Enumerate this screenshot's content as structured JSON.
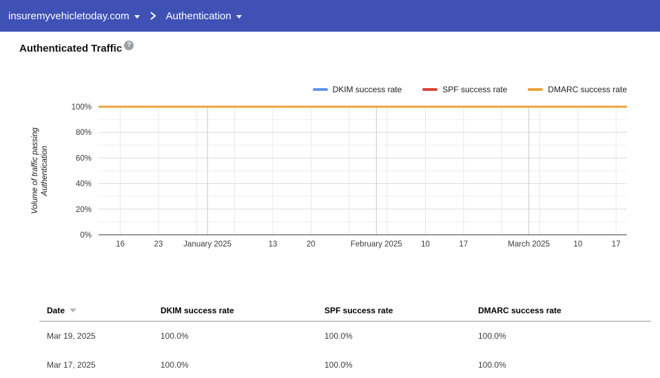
{
  "header": {
    "domain": "insuremyvehicletoday.com",
    "section": "Authentication",
    "bg_color": "#3F51B5"
  },
  "page": {
    "title": "Authenticated Traffic",
    "help_glyph": "?"
  },
  "chart_data": {
    "type": "line",
    "title": "Authenticated Traffic",
    "legend_position": "top-right",
    "grid": true,
    "y_axis": {
      "label": "Volume of traffic passing Authentication",
      "label_lines": [
        "Volume of traffic passing",
        "Authentication"
      ],
      "range": [
        0,
        100
      ],
      "tick_values": [
        0,
        20,
        40,
        60,
        80,
        100
      ],
      "tick_labels": [
        "0%",
        "20%",
        "40%",
        "60%",
        "80%",
        "100%"
      ],
      "minor_gridline_step_percent": 10
    },
    "x_axis": {
      "ticks": [
        {
          "pos": 0.0412,
          "label": "16",
          "month_boundary": false
        },
        {
          "pos": 0.1134,
          "label": "23",
          "month_boundary": false
        },
        {
          "pos": 0.1856,
          "label": "",
          "month_boundary": false
        },
        {
          "pos": 0.2062,
          "label": "January 2025",
          "month_boundary": true
        },
        {
          "pos": 0.2577,
          "label": "",
          "month_boundary": false
        },
        {
          "pos": 0.3299,
          "label": "13",
          "month_boundary": false
        },
        {
          "pos": 0.4021,
          "label": "20",
          "month_boundary": false
        },
        {
          "pos": 0.4742,
          "label": "",
          "month_boundary": false
        },
        {
          "pos": 0.5258,
          "label": "February 2025",
          "month_boundary": true
        },
        {
          "pos": 0.5464,
          "label": "",
          "month_boundary": false
        },
        {
          "pos": 0.6186,
          "label": "10",
          "month_boundary": false
        },
        {
          "pos": 0.6907,
          "label": "17",
          "month_boundary": false
        },
        {
          "pos": 0.7629,
          "label": "",
          "month_boundary": false
        },
        {
          "pos": 0.8144,
          "label": "March 2025",
          "month_boundary": true
        },
        {
          "pos": 0.8351,
          "label": "",
          "month_boundary": false
        },
        {
          "pos": 0.9072,
          "label": "10",
          "month_boundary": false
        },
        {
          "pos": 0.9794,
          "label": "17",
          "month_boundary": false
        }
      ]
    },
    "series": [
      {
        "name": "DKIM success rate",
        "color": "#5E97F6",
        "constant_value_percent": 100
      },
      {
        "name": "SPF success rate",
        "color": "#D84437",
        "constant_value_percent": 100
      },
      {
        "name": "DMARC success rate",
        "color": "#E8A33D",
        "constant_value_percent": 100
      }
    ]
  },
  "table": {
    "columns": [
      "Date",
      "DKIM success rate",
      "SPF success rate",
      "DMARC success rate"
    ],
    "sort_column": "Date",
    "sort_direction": "descending",
    "rows": [
      [
        "Mar 19, 2025",
        "100.0%",
        "100.0%",
        "100.0%"
      ],
      [
        "Mar 17, 2025",
        "100.0%",
        "100.0%",
        "100.0%"
      ]
    ]
  }
}
